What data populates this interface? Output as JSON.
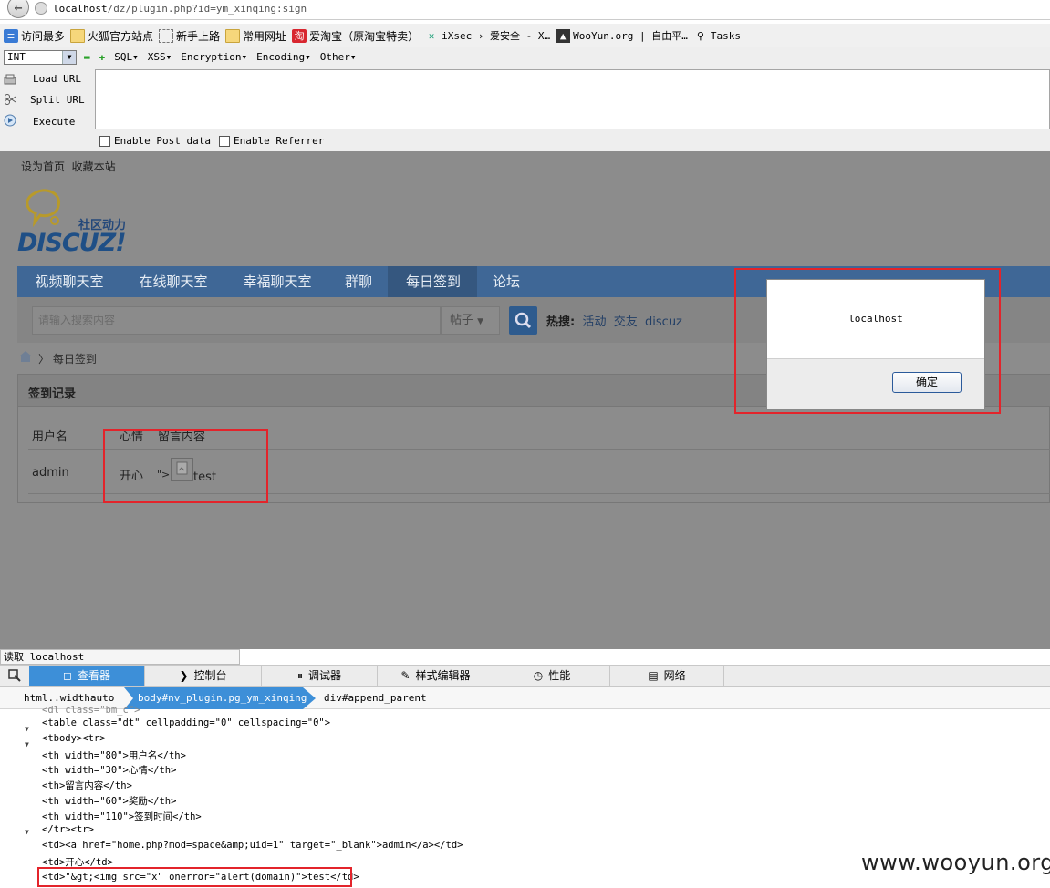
{
  "browser": {
    "url_host": "localhost",
    "url_rest": "/dz/plugin.php?id=ym_xinqing:sign",
    "back_glyph": "←"
  },
  "bookmarks": [
    {
      "label": "访问最多",
      "icon": "blue-list-icon"
    },
    {
      "label": "火狐官方站点",
      "icon": "folder-icon"
    },
    {
      "label": "新手上路",
      "icon": "dotted-page-icon"
    },
    {
      "label": "常用网址",
      "icon": "folder-icon"
    },
    {
      "label": "爱淘宝（原淘宝特卖）",
      "icon": "taobao-icon",
      "glyph": "淘"
    },
    {
      "label": "iXsec › 爱安全 - X…",
      "icon": "ixsec-icon",
      "glyph": "✕"
    },
    {
      "label": "WooYun.org | 自由平…",
      "icon": "wooyun-icon",
      "glyph": "▲"
    },
    {
      "label": "Tasks",
      "icon": "magnifier-icon",
      "glyph": "⚲"
    }
  ],
  "hackbar": {
    "select_value": "INT",
    "select_arrow": "▼",
    "minus": "▬",
    "plus": "✚",
    "menus": [
      "SQL▾",
      "XSS▾",
      "Encryption▾",
      "Encoding▾",
      "Other▾"
    ],
    "load_url": "Load URL",
    "split_url": "Split URL",
    "execute": "Execute",
    "post_label": "Enable Post data",
    "referrer_label": "Enable Referrer"
  },
  "site": {
    "toplinks": [
      "设为首页",
      "收藏本站"
    ],
    "logo_slogan": "社区动力",
    "logo_text": "DISCUZ!",
    "nav": [
      "视频聊天室",
      "在线聊天室",
      "幸福聊天室",
      "群聊",
      "每日签到",
      "论坛"
    ],
    "search_placeholder": "请输入搜索内容",
    "search_type": "帖子",
    "hot_label": "热搜:",
    "hot_words": [
      "活动",
      "交友",
      "discuz"
    ],
    "breadcrumb": "每日签到",
    "panel_title": "签到记录",
    "table_headers": [
      "用户名",
      "心情",
      "留言内容"
    ],
    "row": {
      "user": "admin",
      "mood": "开心",
      "msg_prefix": "\">",
      "msg_text": "test"
    }
  },
  "alert": {
    "message": "localhost",
    "ok_label": "确定"
  },
  "status_text": "读取 localhost",
  "devtools": {
    "tabs": [
      {
        "label": "查看器",
        "icon": "inspector-icon"
      },
      {
        "label": "控制台",
        "icon": "console-icon"
      },
      {
        "label": "调试器",
        "icon": "debugger-icon"
      },
      {
        "label": "样式编辑器",
        "icon": "style-editor-icon"
      },
      {
        "label": "性能",
        "icon": "performance-icon"
      },
      {
        "label": "网络",
        "icon": "network-icon"
      }
    ],
    "tab_glyphs": [
      "◻",
      "❯",
      "⏸",
      "✎",
      "◷",
      "▤"
    ],
    "crumbs": [
      "html..widthauto",
      "body#nv_plugin.pg_ym_xinqing",
      "div#append_parent"
    ],
    "markup_lines": [
      "<dl class=\"bm_c\">",
      "<table class=\"dt\" cellpadding=\"0\" cellspacing=\"0\">",
      "<tbody><tr>",
      "<th width=\"80\">用户名</th>",
      "<th width=\"30\">心情</th>",
      "<th>留言内容</th>",
      "<th width=\"60\">奖励</th>",
      "<th width=\"110\">签到时间</th>",
      "</tr><tr>",
      "<td><a href=\"home.php?mod=space&amp;uid=1\" target=\"_blank\">admin</a></td>",
      "<td>开心</td>",
      "<td>\"&gt;<img src=\"x\" onerror=\"alert(domain)\">test</td>"
    ]
  },
  "watermark": "www.wooyun.org",
  "colors": {
    "page_overlay": "#8c8c8c",
    "nav_bar": "#3f6796",
    "highlight_red": "#e3242b",
    "devtools_active": "#3d8fd8"
  }
}
